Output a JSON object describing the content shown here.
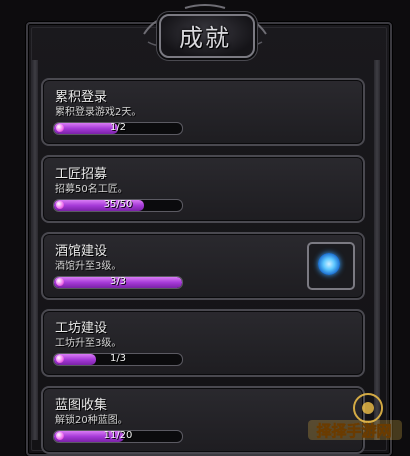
{
  "header": {
    "title": "成就"
  },
  "achievements": [
    {
      "name": "累积登录",
      "desc": "累积登录游戏2天。",
      "progress_text": "1/2",
      "progress": 0.5,
      "has_reward": false
    },
    {
      "name": "工匠招募",
      "desc": "招募50名工匠。",
      "progress_text": "35/50",
      "progress": 0.7,
      "has_reward": false
    },
    {
      "name": "酒馆建设",
      "desc": "酒馆升至3级。",
      "progress_text": "3/3",
      "progress": 1.0,
      "has_reward": true,
      "reward_icon": "blue-orb-icon"
    },
    {
      "name": "工坊建设",
      "desc": "工坊升至3级。",
      "progress_text": "1/3",
      "progress": 0.33,
      "has_reward": false
    },
    {
      "name": "蓝图收集",
      "desc": "解锁20种蓝图。",
      "progress_text": "11/20",
      "progress": 0.55,
      "has_reward": false
    }
  ],
  "colors": {
    "progress_fill": "#a63ad8",
    "frame": "#4a4950"
  }
}
